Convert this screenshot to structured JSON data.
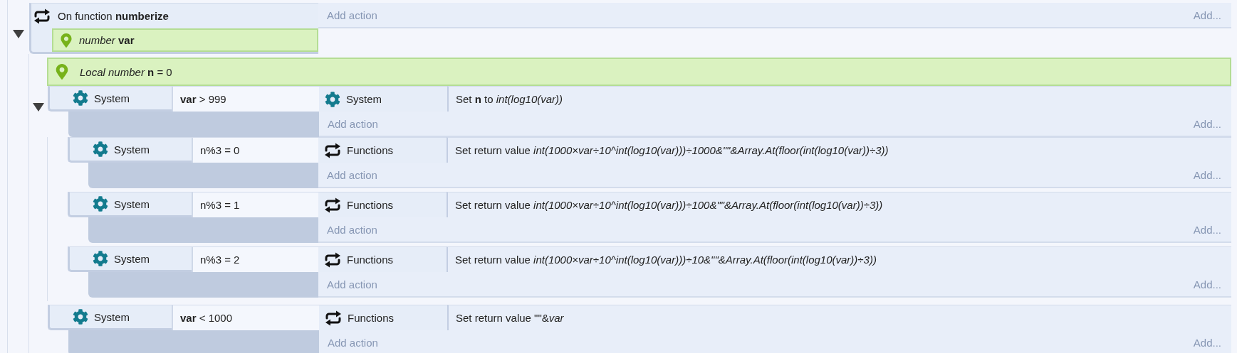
{
  "function": {
    "expanded": true,
    "kind": "functions",
    "title": "On function **numberize**",
    "add_action": "Add action",
    "add": "Add...",
    "parameters": [
      {
        "text": "*number* **var**"
      }
    ],
    "local_variables": [
      {
        "text": "*Local number* **n** = 0"
      }
    ],
    "events": [
      {
        "expanded": true,
        "conditions": [
          {
            "kind": "system",
            "object": "System",
            "expression": "**var** > 999"
          }
        ],
        "actions": [
          {
            "kind": "system",
            "object": "System",
            "text": "Set **n** to *int(log10(var))*"
          }
        ],
        "add_action": "Add action",
        "add": "Add...",
        "children": [
          {
            "conditions": [
              {
                "kind": "system",
                "object": "System",
                "expression": "n%3 = 0"
              }
            ],
            "actions": [
              {
                "kind": "functions",
                "object": "Functions",
                "text": "Set return value *int(1000×var÷10^int(log10(var)))÷1000&\"\"&Array.At(floor(int(log10(var))÷3))*"
              }
            ],
            "add_action": "Add action",
            "add": "Add..."
          },
          {
            "conditions": [
              {
                "kind": "system",
                "object": "System",
                "expression": "n%3 = 1"
              }
            ],
            "actions": [
              {
                "kind": "functions",
                "object": "Functions",
                "text": "Set return value *int(1000×var÷10^int(log10(var)))÷100&\"\"&Array.At(floor(int(log10(var))÷3))*"
              }
            ],
            "add_action": "Add action",
            "add": "Add..."
          },
          {
            "conditions": [
              {
                "kind": "system",
                "object": "System",
                "expression": "n%3 = 2"
              }
            ],
            "actions": [
              {
                "kind": "functions",
                "object": "Functions",
                "text": "Set return value *int(1000×var÷10^int(log10(var)))÷10&\"\"&Array.At(floor(int(log10(var))÷3))*"
              }
            ],
            "add_action": "Add action",
            "add": "Add..."
          }
        ]
      },
      {
        "conditions": [
          {
            "kind": "system",
            "object": "System",
            "expression": "**var** < 1000"
          }
        ],
        "actions": [
          {
            "kind": "functions",
            "object": "Functions",
            "text": "Set return value \"\"&*var*"
          }
        ],
        "add_action": "Add action",
        "add": "Add..."
      }
    ]
  }
}
